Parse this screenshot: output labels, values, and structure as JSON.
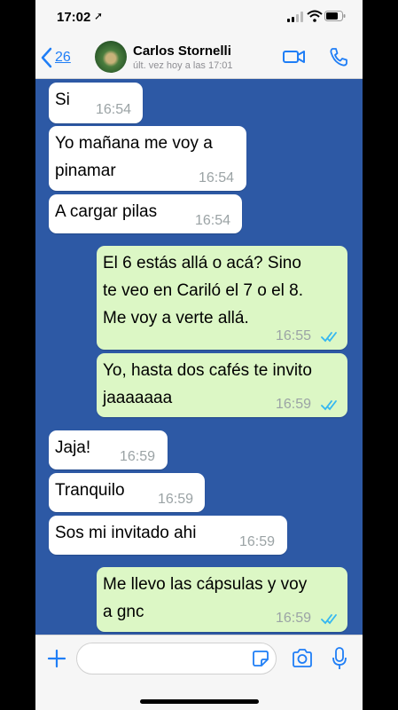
{
  "status_bar": {
    "time": "17:02",
    "location_arrow": "➚"
  },
  "header": {
    "back_count": "26",
    "contact_name": "Carlos Stornelli",
    "last_seen": "últ. vez hoy a las 17:01"
  },
  "messages": [
    {
      "direction": "in",
      "lines": [
        "Si"
      ],
      "time": "16:54"
    },
    {
      "direction": "in",
      "lines": [
        "Yo mañana me voy a",
        "pinamar"
      ],
      "time": "16:54"
    },
    {
      "direction": "in",
      "lines": [
        "A cargar pilas"
      ],
      "time": "16:54"
    },
    {
      "direction": "out",
      "lines": [
        "El 6 estás allá o acá? Sino",
        "te veo en Cariló el 7 o el 8.",
        "Me voy a verte allá."
      ],
      "time": "16:55",
      "read": true
    },
    {
      "direction": "out",
      "lines": [
        "Yo, hasta dos cafés te invito",
        "jaaaaaaa"
      ],
      "time": "16:59",
      "read": true
    },
    {
      "direction": "in",
      "lines": [
        "Jaja!"
      ],
      "time": "16:59"
    },
    {
      "direction": "in",
      "lines": [
        "Tranquilo"
      ],
      "time": "16:59"
    },
    {
      "direction": "in",
      "lines": [
        "Sos mi invitado ahi"
      ],
      "time": "16:59"
    },
    {
      "direction": "out",
      "lines": [
        "Me llevo las cápsulas y voy",
        "a gnc"
      ],
      "time": "16:59",
      "read": true
    }
  ],
  "input_bar": {
    "placeholder": ""
  },
  "colors": {
    "chat_background": "#2d59a5",
    "outgoing_bubble": "#dcf7c5",
    "incoming_bubble": "#ffffff",
    "accent": "#1f7ef6",
    "read_ticks": "#34b7f1"
  },
  "icons": [
    "location-arrow-icon",
    "signal-icon",
    "wifi-icon",
    "battery-icon",
    "back-chevron-icon",
    "video-call-icon",
    "phone-icon",
    "plus-icon",
    "sticker-icon",
    "camera-icon",
    "microphone-icon",
    "double-check-icon"
  ]
}
